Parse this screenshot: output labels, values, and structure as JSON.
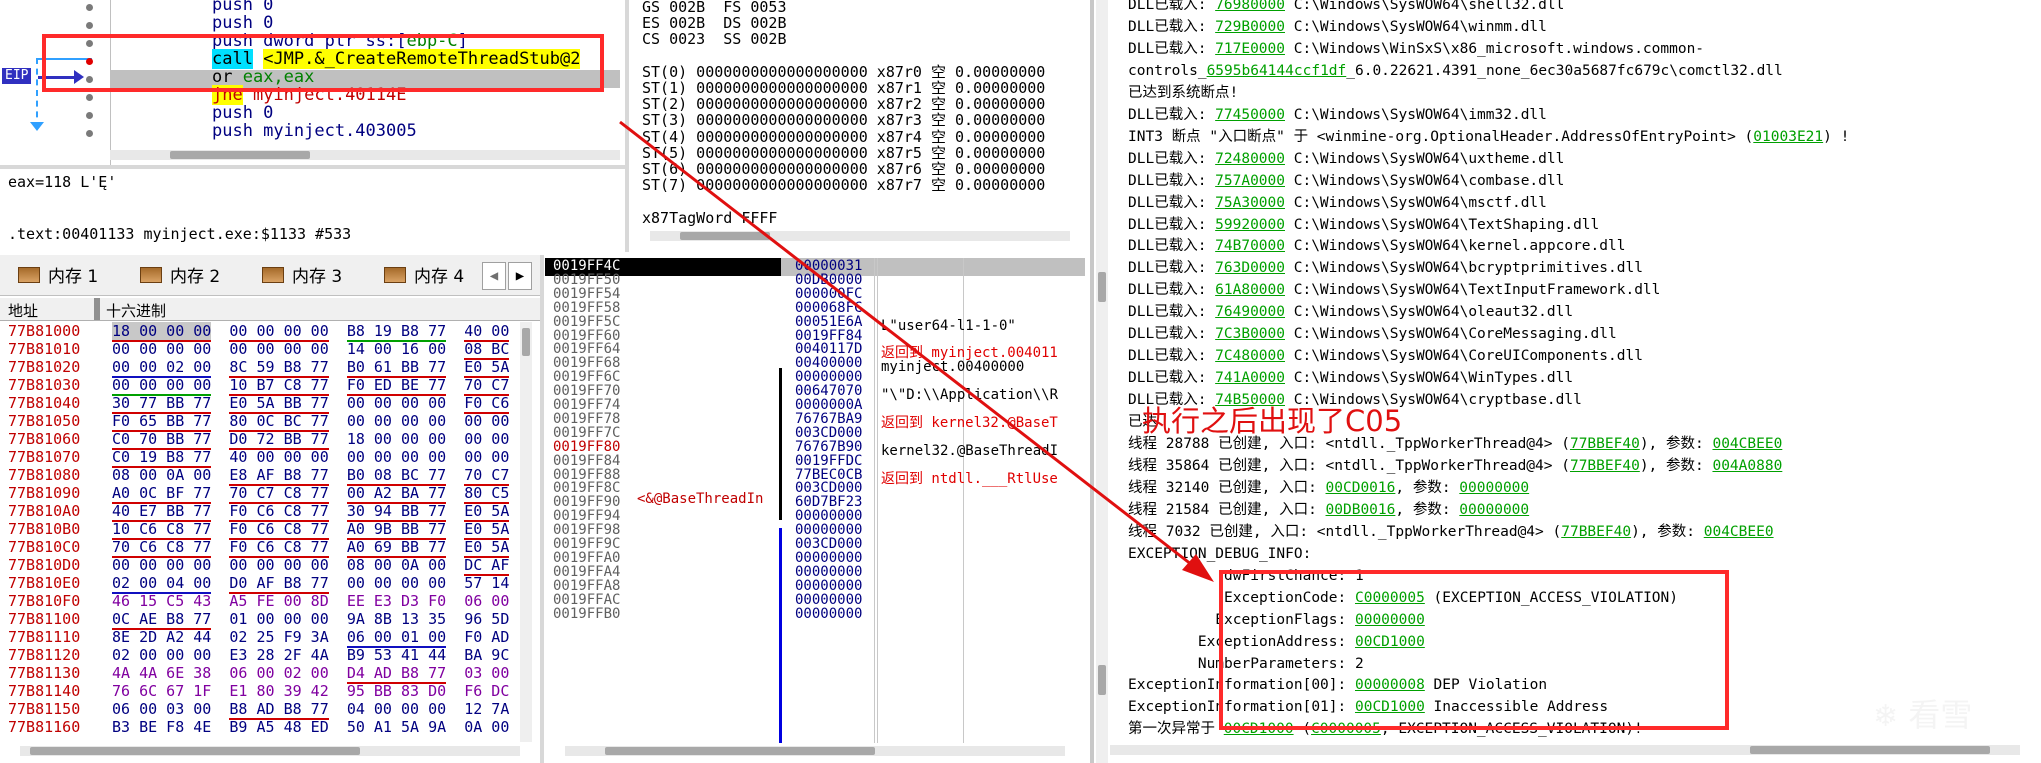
{
  "disasm": {
    "lines": [
      {
        "text": "push 0"
      },
      {
        "text": "push 0"
      },
      {
        "text": "push dword ptr ss:[ebp-C]"
      },
      {
        "text": "call <JMP.&_CreateRemoteThreadStub@2"
      },
      {
        "text": "or eax,eax"
      },
      {
        "text": "jne myinject.40114E"
      },
      {
        "text": "push 0"
      },
      {
        "text": "push myinject.403005"
      }
    ],
    "eip_label": "EIP"
  },
  "info": {
    "line1": "eax=118 L'Ę'",
    "line2": ".text:00401133 myinject.exe:$1133 #533"
  },
  "registers": {
    "lines": [
      "GS 002B  FS 0053",
      "ES 002B  DS 002B",
      "CS 0023  SS 002B",
      "",
      "ST(0) 0000000000000000000 x87r0 空 0.00000000",
      "ST(1) 0000000000000000000 x87r1 空 0.00000000",
      "ST(2) 0000000000000000000 x87r2 空 0.00000000",
      "ST(3) 0000000000000000000 x87r3 空 0.00000000",
      "ST(4) 0000000000000000000 x87r4 空 0.00000000",
      "ST(5) 0000000000000000000 x87r5 空 0.00000000",
      "ST(6) 0000000000000000000 x87r6 空 0.00000000",
      "ST(7) 0000000000000000000 x87r7 空 0.00000000",
      "",
      "x87TagWord FFFF"
    ]
  },
  "memory_tabs": [
    "内存 1",
    "内存 2",
    "内存 3",
    "内存 4"
  ],
  "hexdump": {
    "col_addr": "地址",
    "col_hex": "十六进制",
    "rows": [
      {
        "addr": "77B81000",
        "bytes": "18 00 00 00 00 00 00 00 B8 19 B8 77 40 00"
      },
      {
        "addr": "77B81010",
        "bytes": "00 00 00 00 00 00 00 00 14 00 16 00 08 BC"
      },
      {
        "addr": "77B81020",
        "bytes": "00 00 02 00 8C 59 B8 77 B0 61 BB 77 E0 5A"
      },
      {
        "addr": "77B81030",
        "bytes": "00 00 00 00 10 B7 C8 77 F0 ED BE 77 70 C7"
      },
      {
        "addr": "77B81040",
        "bytes": "30 77 BB 77 E0 5A BB 77 00 00 00 00 F0 C6"
      },
      {
        "addr": "77B81050",
        "bytes": "F0 65 BB 77 80 0C BC 77 00 00 00 00 00 00"
      },
      {
        "addr": "77B81060",
        "bytes": "C0 70 BB 77 D0 72 BB 77 18 00 00 00 00 00"
      },
      {
        "addr": "77B81070",
        "bytes": "C0 19 B8 77 40 00 00 00 00 00 00 00 00 00"
      },
      {
        "addr": "77B81080",
        "bytes": "08 00 0A 00 E8 AF B8 77 B0 08 BC 77 70 C7"
      },
      {
        "addr": "77B81090",
        "bytes": "A0 0C BF 77 70 C7 C8 77 00 A2 BA 77 80 C5"
      },
      {
        "addr": "77B810A0",
        "bytes": "40 E7 BB 77 F0 C6 C8 77 30 94 BB 77 E0 5A"
      },
      {
        "addr": "77B810B0",
        "bytes": "10 C6 C8 77 F0 C6 C8 77 A0 9B BB 77 E0 5A"
      },
      {
        "addr": "77B810C0",
        "bytes": "70 C6 C8 77 F0 C6 C8 77 A0 69 BB 77 E0 5A"
      },
      {
        "addr": "77B810D0",
        "bytes": "00 00 00 00 00 00 00 00 08 00 0A 00 DC AF"
      },
      {
        "addr": "77B810E0",
        "bytes": "02 00 04 00 D0 AF B8 77 00 00 00 00 57 14"
      },
      {
        "addr": "77B810F0",
        "bytes": "46 15 C5 43 A5 FE 00 8D EE E3 D3 F0 06 00"
      },
      {
        "addr": "77B81100",
        "bytes": "0C AE B8 77 01 00 00 00 9A 8B 13 35 96 5D"
      },
      {
        "addr": "77B81110",
        "bytes": "8E 2D A2 44 02 25 F9 3A 06 00 01 00 F0 AD"
      },
      {
        "addr": "77B81120",
        "bytes": "02 00 00 00 E3 28 2F 4A B9 53 41 44 BA 9C"
      },
      {
        "addr": "77B81130",
        "bytes": "4A 4A 6E 38 06 00 02 00 D4 AD B8 77 03 00"
      },
      {
        "addr": "77B81140",
        "bytes": "76 6C 67 1F E1 80 39 42 95 BB 83 D0 F6 DC"
      },
      {
        "addr": "77B81150",
        "bytes": "06 00 03 00 B8 AD B8 77 04 00 00 00 12 7A"
      },
      {
        "addr": "77B81160",
        "bytes": "B3 BE F8 4E B9 A5 48 ED 50 A1 5A 9A 0A 00"
      }
    ]
  },
  "stack": {
    "rows": [
      {
        "addr": "0019FF4C",
        "val": "00000031",
        "comment": ""
      },
      {
        "addr": "0019FF50",
        "val": "00DB0000",
        "comment": ""
      },
      {
        "addr": "0019FF54",
        "val": "000000FC",
        "comment": ""
      },
      {
        "addr": "0019FF58",
        "val": "000068FC",
        "comment": ""
      },
      {
        "addr": "0019FF5C",
        "val": "00051E6A",
        "comment": "L\"user64-l1-1-0\""
      },
      {
        "addr": "0019FF60",
        "val": "0019FF84",
        "comment": ""
      },
      {
        "addr": "0019FF64",
        "val": "0040117D",
        "comment": "返回到 myinject.004011"
      },
      {
        "addr": "0019FF68",
        "val": "00400000",
        "comment": "myinject.00400000"
      },
      {
        "addr": "0019FF6C",
        "val": "00000000",
        "comment": ""
      },
      {
        "addr": "0019FF70",
        "val": "00647070",
        "comment": "\"\\\"D:\\\\Application\\\\R"
      },
      {
        "addr": "0019FF74",
        "val": "0000000A",
        "comment": ""
      },
      {
        "addr": "0019FF78",
        "val": "76767BA9",
        "comment": "返回到 kernel32.@BaseT"
      },
      {
        "addr": "0019FF7C",
        "val": "003CD000",
        "comment": ""
      },
      {
        "addr": "0019FF80",
        "val": "76767B90",
        "comment": "kernel32.@BaseThreadI"
      },
      {
        "addr": "0019FF84",
        "val": "0019FFDC",
        "comment": ""
      },
      {
        "addr": "0019FF88",
        "val": "77BEC0CB",
        "comment": "返回到 ntdll.___RtlUse"
      },
      {
        "addr": "0019FF8C",
        "val": "003CD000",
        "comment": ""
      },
      {
        "addr": "0019FF90",
        "val": "60D7BF23",
        "comment": ""
      },
      {
        "addr": "0019FF94",
        "val": "00000000",
        "comment": ""
      },
      {
        "addr": "0019FF98",
        "val": "00000000",
        "comment": ""
      },
      {
        "addr": "0019FF9C",
        "val": "003CD000",
        "comment": ""
      },
      {
        "addr": "0019FFA0",
        "val": "00000000",
        "comment": ""
      },
      {
        "addr": "0019FFA4",
        "val": "00000000",
        "comment": ""
      },
      {
        "addr": "0019FFA8",
        "val": "00000000",
        "comment": ""
      },
      {
        "addr": "0019FFAC",
        "val": "00000000",
        "comment": ""
      },
      {
        "addr": "0019FFB0",
        "val": "00000000",
        "comment": ""
      }
    ],
    "ebp_label": "<&@BaseThreadIn"
  },
  "log": {
    "lines": [
      {
        "pre": "DLL已载入: ",
        "link": "76980000",
        "post": " C:\\Windows\\SysWOW64\\shell32.dll"
      },
      {
        "pre": "DLL已载入: ",
        "link": "729B0000",
        "post": " C:\\Windows\\SysWOW64\\winmm.dll"
      },
      {
        "pre": "DLL已载入: ",
        "link": "717E0000",
        "post": " C:\\Windows\\WinSxS\\x86_microsoft.windows.common-"
      },
      {
        "pre": "controls_",
        "link": "6595b64144ccf1df",
        "post": "_6.0.22621.4391_none_6ec30a5687fc679c\\comctl32.dll"
      },
      {
        "pre": "已达到系统断点!",
        "link": "",
        "post": ""
      },
      {
        "pre": "DLL已载入: ",
        "link": "77450000",
        "post": " C:\\Windows\\SysWOW64\\imm32.dll"
      },
      {
        "pre": "INT3 断点 \"入口断点\" 于 <winmine-org.OptionalHeader.AddressOfEntryPoint> (",
        "link": "01003E21",
        "post": ") !"
      },
      {
        "pre": "DLL已载入: ",
        "link": "72480000",
        "post": " C:\\Windows\\SysWOW64\\uxtheme.dll"
      },
      {
        "pre": "DLL已载入: ",
        "link": "757A0000",
        "post": " C:\\Windows\\SysWOW64\\combase.dll"
      },
      {
        "pre": "DLL已载入: ",
        "link": "75A30000",
        "post": " C:\\Windows\\SysWOW64\\msctf.dll"
      },
      {
        "pre": "DLL已载入: ",
        "link": "59920000",
        "post": " C:\\Windows\\SysWOW64\\TextShaping.dll"
      },
      {
        "pre": "DLL已载入: ",
        "link": "74B70000",
        "post": " C:\\Windows\\SysWOW64\\kernel.appcore.dll"
      },
      {
        "pre": "DLL已载入: ",
        "link": "763D0000",
        "post": " C:\\Windows\\SysWOW64\\bcryptprimitives.dll"
      },
      {
        "pre": "DLL已载入: ",
        "link": "61A80000",
        "post": " C:\\Windows\\SysWOW64\\TextInputFramework.dll"
      },
      {
        "pre": "DLL已载入: ",
        "link": "76490000",
        "post": " C:\\Windows\\SysWOW64\\oleaut32.dll"
      },
      {
        "pre": "DLL已载入: ",
        "link": "7C3B0000",
        "post": " C:\\Windows\\SysWOW64\\CoreMessaging.dll"
      },
      {
        "pre": "DLL已载入: ",
        "link": "7C480000",
        "post": " C:\\Windows\\SysWOW64\\CoreUIComponents.dll"
      },
      {
        "pre": "DLL已载入: ",
        "link": "741A0000",
        "post": " C:\\Windows\\SysWOW64\\WinTypes.dll"
      },
      {
        "pre": "DLL已载入: ",
        "link": "74B50000",
        "post": " C:\\Windows\\SysWOW64\\cryptbase.dll"
      },
      {
        "pre": "已达",
        "link": "",
        "post": ""
      },
      {
        "pre": "线程 28788 已创建, 入口: <ntdll._TppWorkerThread@4> (",
        "link": "77BBEF40",
        "post": "), 参数: ",
        "link2": "004CBEE0"
      },
      {
        "pre": "线程 35864 已创建, 入口: <ntdll._TppWorkerThread@4> (",
        "link": "77BBEF40",
        "post": "), 参数: ",
        "link2": "004A0880"
      },
      {
        "pre": "线程 32140 已创建, 入口: ",
        "link": "00CD0016",
        "post": ", 参数: ",
        "link2": "00000000"
      },
      {
        "pre": "线程 21584 已创建, 入口: ",
        "link": "00DB0016",
        "post": ", 参数: ",
        "link2": "00000000"
      },
      {
        "pre": "线程 7032 已创建, 入口: <ntdll._TppWorkerThread@4> (",
        "link": "77BBEF40",
        "post": "), 参数: ",
        "link2": "004CBEE0"
      },
      {
        "pre": "EXCEPTION_DEBUG_INFO:",
        "link": "",
        "post": ""
      },
      {
        "pre": "           dwFirstChance: 1",
        "link": "",
        "post": ""
      },
      {
        "pre": "           ExceptionCode: ",
        "link": "C0000005",
        "post": " (EXCEPTION_ACCESS_VIOLATION)"
      },
      {
        "pre": "          ExceptionFlags: ",
        "link": "00000000",
        "post": ""
      },
      {
        "pre": "        ExceptionAddress: ",
        "link": "00CD1000",
        "post": ""
      },
      {
        "pre": "        NumberParameters: 2",
        "link": "",
        "post": ""
      },
      {
        "pre": "ExceptionInformation[00]: ",
        "link": "00000008",
        "post": " DEP Violation"
      },
      {
        "pre": "ExceptionInformation[01]: ",
        "link": "00CD1000",
        "post": " Inaccessible Address"
      },
      {
        "pre": "第一次异常于 ",
        "link": "00CD1000",
        "post": " (",
        "link2": "C0000005",
        "post2": ", EXCEPTION_ACCESS_VIOLATION)!"
      }
    ]
  },
  "annotation": {
    "text": "执行之后出现了C05"
  },
  "watermark": "看雪"
}
